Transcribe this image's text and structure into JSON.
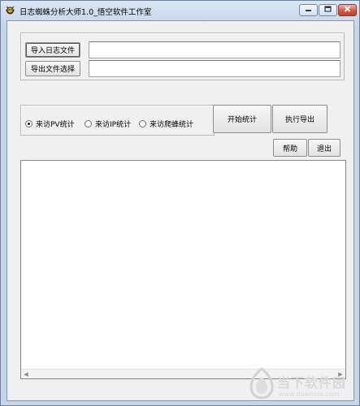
{
  "window": {
    "title": "日志蜘蛛分析大师1.0_悟空软件工作室"
  },
  "import_panel": {
    "import_log_button": "导入日志文件",
    "export_file_button": "导出文件选择",
    "import_path_value": "",
    "export_path_value": ""
  },
  "stats_options": {
    "options": [
      {
        "label": "来访PV统计",
        "checked": true
      },
      {
        "label": "来访IP统计",
        "checked": false
      },
      {
        "label": "来访爬蜂统计",
        "checked": false
      }
    ]
  },
  "actions": {
    "start_stats_button": "开始统计",
    "export_button": "执行导出",
    "help_button": "帮助",
    "exit_button": "退出"
  },
  "output": {
    "text": ""
  },
  "watermark": {
    "text": "当下软件园",
    "url": "www.downxia.com"
  },
  "colors": {
    "title_bar": "#c5d6ea",
    "client_bg": "#f0f0f0",
    "close_button": "#c1412a"
  }
}
